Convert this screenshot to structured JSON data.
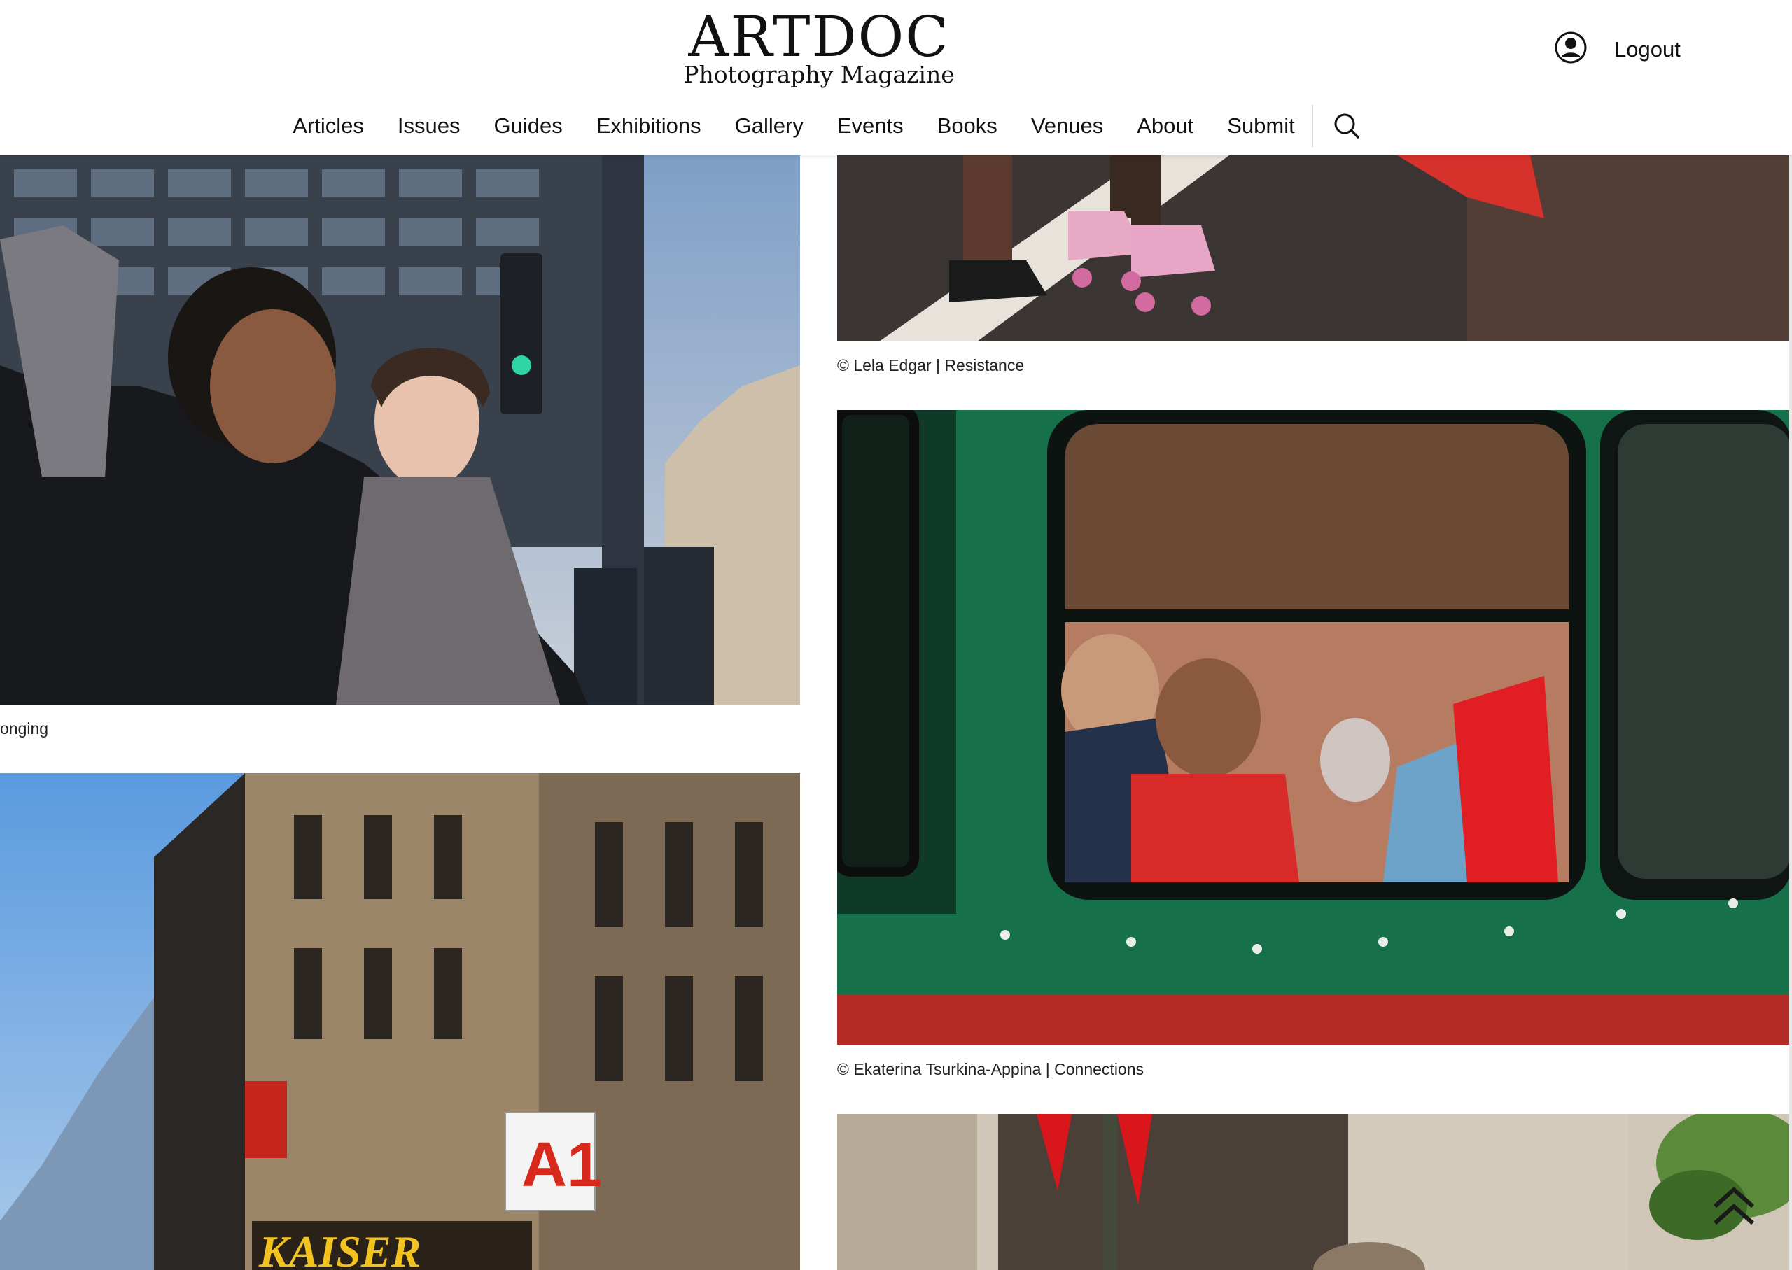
{
  "brand": {
    "title": "ARTDOC",
    "subtitle": "Photography Magazine"
  },
  "account": {
    "icon": "user-circle-icon",
    "logout_label": "Logout"
  },
  "nav": {
    "items": [
      "Articles",
      "Issues",
      "Guides",
      "Exhibitions",
      "Gallery",
      "Events",
      "Books",
      "Venues",
      "About",
      "Submit"
    ],
    "search_icon": "search-icon"
  },
  "gallery": {
    "left": [
      {
        "caption": "onging"
      },
      {
        "caption": ""
      }
    ],
    "right": [
      {
        "caption": "© Lela Edgar | Resistance"
      },
      {
        "caption": "© Ekaterina Tsurkina-Appina | Connections"
      },
      {
        "caption": ""
      }
    ]
  },
  "scroll_top_icon": "double-chevron-up-icon"
}
